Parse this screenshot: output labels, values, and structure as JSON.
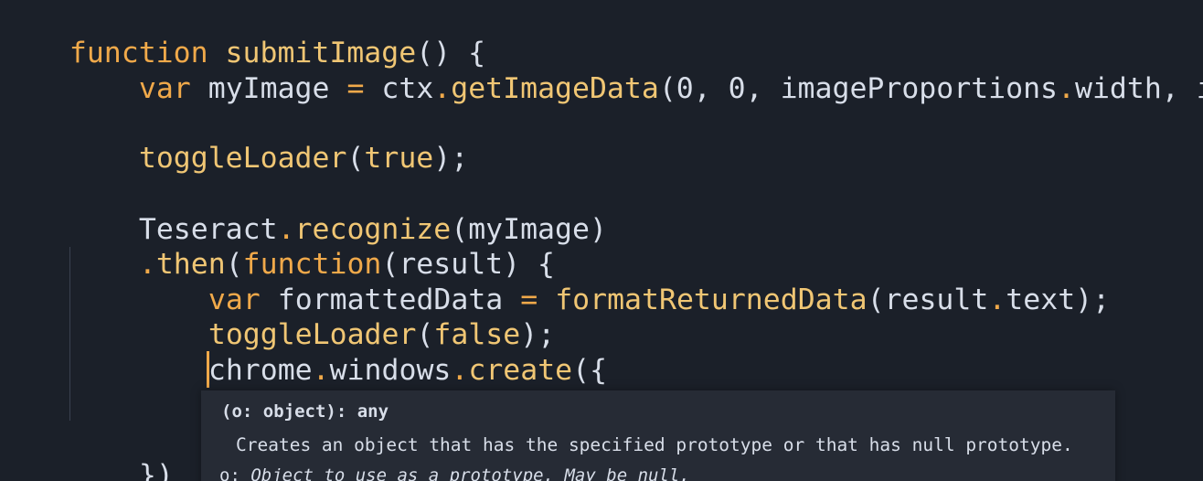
{
  "editor": {
    "lines": [
      {
        "id": "l1",
        "tokens": [
          "function",
          " ",
          "submitImage",
          "() {"
        ]
      },
      {
        "id": "l2",
        "tokens": [
          "var",
          " myImage ",
          "=",
          " ctx",
          ".",
          "getImageData",
          "(0, 0, imageProportions",
          ".",
          "width, image"
        ]
      },
      {
        "id": "l3",
        "tokens": []
      },
      {
        "id": "l4",
        "tokens": [
          "toggleLoader",
          "(",
          "true",
          ");"
        ]
      },
      {
        "id": "l5",
        "tokens": []
      },
      {
        "id": "l6",
        "tokens": [
          "Teseract",
          ".",
          "recognize",
          "(myImage)"
        ]
      },
      {
        "id": "l7",
        "tokens": [
          ".",
          "then",
          "(",
          "function",
          "(result) {"
        ]
      },
      {
        "id": "l8",
        "tokens": [
          "var",
          " formattedData ",
          "=",
          " ",
          "formatReturnedData",
          "(result",
          ".",
          "text);"
        ]
      },
      {
        "id": "l9",
        "tokens": [
          "toggleLoader",
          "(",
          "false",
          ");"
        ]
      },
      {
        "id": "l10",
        "tokens": [
          "chrome",
          ".",
          "windows",
          ".",
          "create",
          "({"
        ]
      },
      {
        "id": "l11",
        "tokens": []
      },
      {
        "id": "l12",
        "tokens": [
          "})"
        ]
      },
      {
        "id": "l13",
        "tokens": [
          "})"
        ]
      }
    ]
  },
  "tooltip": {
    "signature": "(o: object): any",
    "description": "Creates an object that has the specified prototype or that has null prototype.",
    "param_name": "o: ",
    "param_desc": "Object to use as a prototype. May be null."
  },
  "colors": {
    "background": "#1b2029",
    "keyword": "#f0a94a",
    "function": "#f0c674",
    "text": "#d8dee9",
    "tooltip_bg": "#262b35"
  }
}
